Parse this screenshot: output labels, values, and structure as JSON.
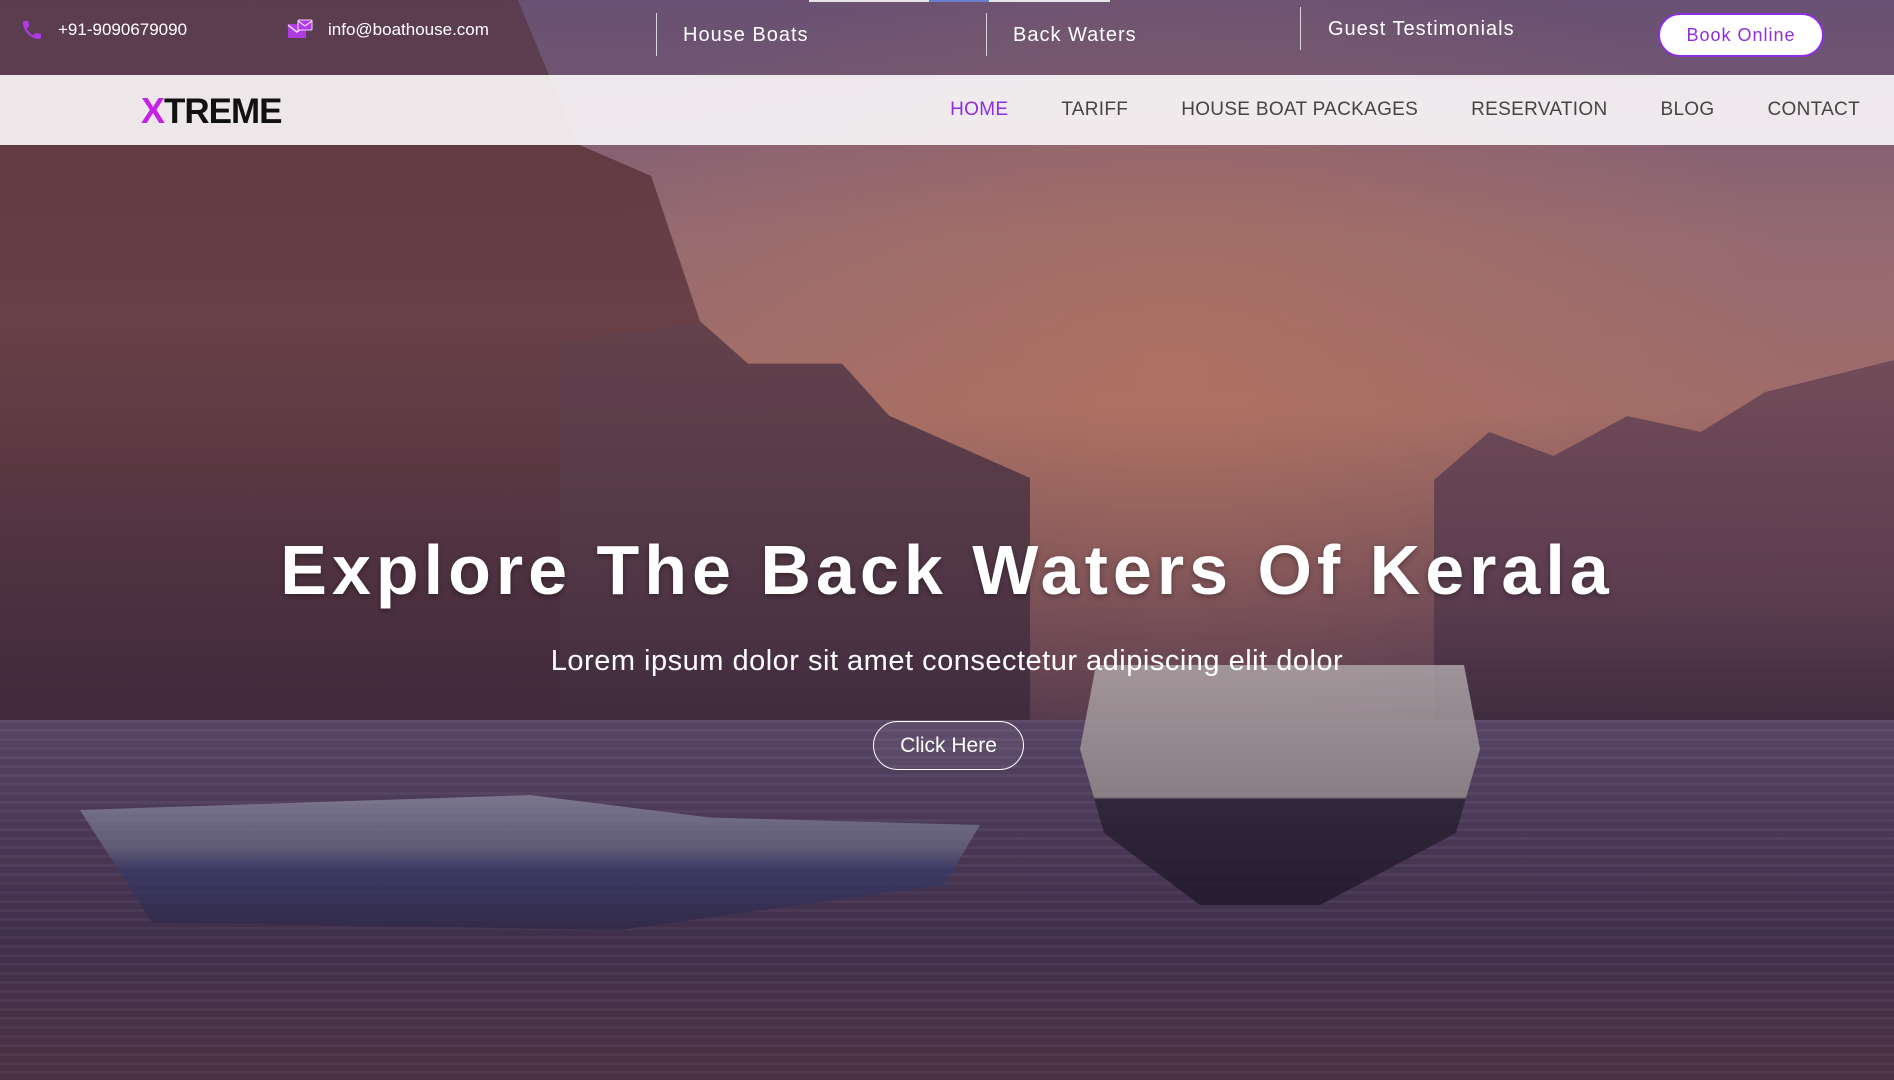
{
  "topbar": {
    "phone": "+91-9090679090",
    "email": "info@boathouse.com",
    "links": [
      "House Boats",
      "Back Waters",
      "Guest Testimonials"
    ],
    "book_online": "Book Online"
  },
  "nav": {
    "logo_mark": "X",
    "logo_text": "TREME",
    "items": [
      "HOME",
      "TARIFF",
      "HOUSE BOAT PACKAGES",
      "RESERVATION",
      "BLOG",
      "CONTACT"
    ],
    "active": "HOME"
  },
  "hero": {
    "title": "Explore The Back Waters Of Kerala",
    "subtitle": "Lorem ipsum dolor sit amet consectetur adipiscing elit dolor",
    "cta": "Click Here"
  },
  "colors": {
    "accent": "#8e2de2",
    "logo_accent": "#c622e5",
    "nav_bg": "#f5f2f4"
  },
  "icons": {
    "phone": "phone-icon",
    "email": "email-icon"
  }
}
